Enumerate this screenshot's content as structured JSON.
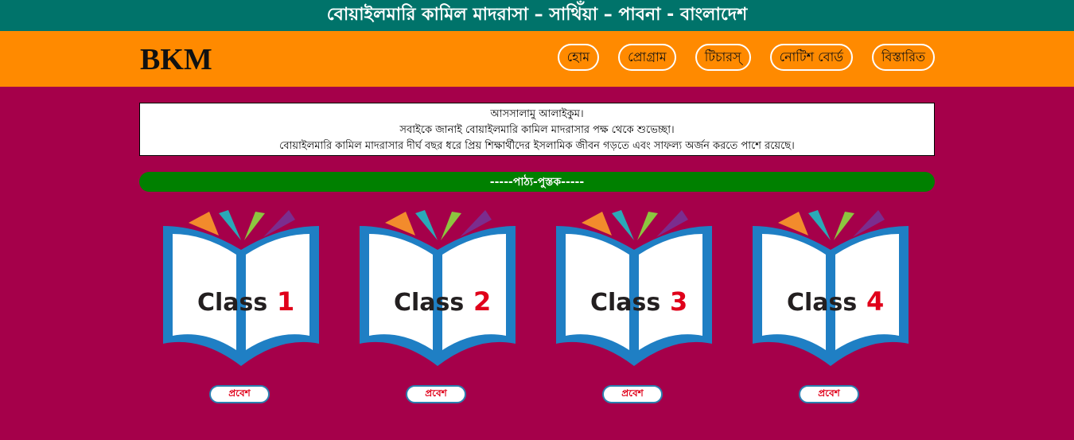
{
  "header": {
    "title": "বোয়াইলমারি কামিল মাদরাসা – সাথিঁয়া – পাবনা - বাংলাদেশ"
  },
  "nav": {
    "logo": "BKM",
    "items": [
      "হোম",
      "প্রোগ্রাম",
      "টিচারস্",
      "নোটিশ বোর্ড",
      "বিস্তারিত"
    ]
  },
  "notice": {
    "lines": [
      "আসসালামু আলাইকুম।",
      "সবাইকে জানাই বোয়াইলমারি কামিল মাদরাসার পক্ষ থেকে শুভেচ্ছা।",
      "বোয়াইলমারি কামিল মাদরাসার দীর্ঘ বছর ধরে প্রিয় শিক্ষার্থীদের ইসলামিক জীবন গড়তে এবং সাফল্য অর্জন করতে পাশে রয়েছে।"
    ]
  },
  "section": {
    "title": "-----পাঠ্য-পুস্তক-----"
  },
  "classes": [
    {
      "word": "Class",
      "number": "1",
      "button": "প্রবেশ"
    },
    {
      "word": "Class",
      "number": "2",
      "button": "প্রবেশ"
    },
    {
      "word": "Class",
      "number": "3",
      "button": "প্রবেশ"
    },
    {
      "word": "Class",
      "number": "4",
      "button": "প্রবেশ"
    }
  ],
  "colors": {
    "topbar": "#00736a",
    "navbar": "#ff8a00",
    "background": "#a5004a",
    "banner": "#008000",
    "book_blue": "#1f7fc4",
    "number_red": "#e0001a"
  }
}
